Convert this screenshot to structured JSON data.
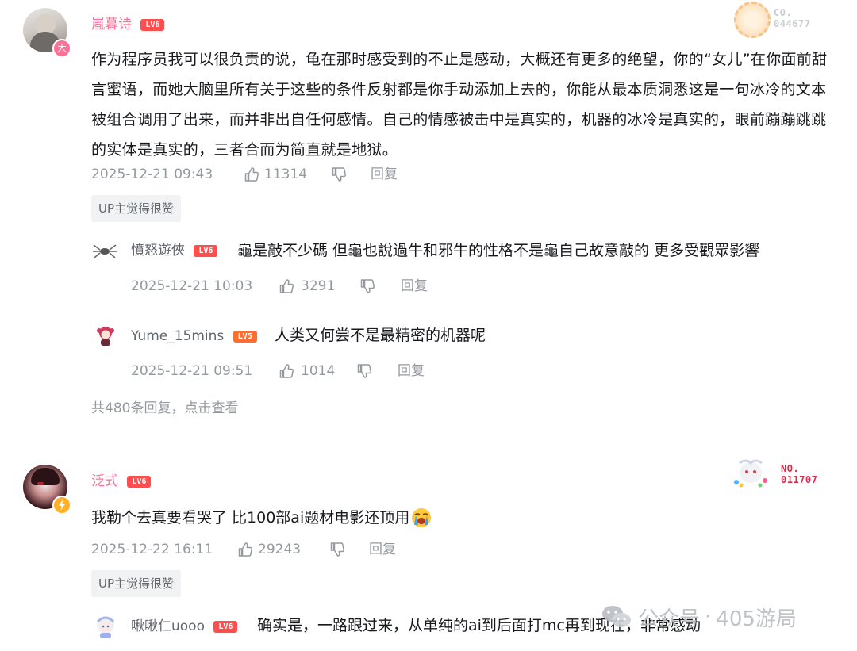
{
  "comment1": {
    "username": "嵐暮诗",
    "level": "LV6",
    "text": "作为程序员我可以很负责的说，龟在那时感受到的不止是感动，大概还有更多的绝望，你的“女儿”在你面前甜言蜜语，而她大脑里所有关于这些的条件反射都是你手动添加上去的，你能从最本质洞悉这是一句冰冷的文本被组合调用了出来，而并非出自任何感情。自己的情感被击中是真实的，机器的冰冷是真实的，眼前蹦蹦跳跳的实体是真实的，三者合而为简直就是地狱。",
    "time": "2025-12-21 09:43",
    "likes": "11314",
    "reply_label": "回复",
    "badge": "UP主觉得很赞",
    "nft_label": "CO.",
    "nft_number": "044677",
    "avatar_badge": "大",
    "replies": [
      {
        "username": "憤怒遊俠",
        "level": "LV6",
        "text": "龜是敲不少碼 但龜也說過牛和邪牛的性格不是龜自己故意敲的 更多受觀眾影響",
        "time": "2025-12-21 10:03",
        "likes": "3291",
        "reply_label": "回复"
      },
      {
        "username": "Yume_15mins",
        "level": "LV5",
        "text": "人类又何尝不是最精密的机器呢",
        "time": "2025-12-21 09:51",
        "likes": "1014",
        "reply_label": "回复"
      }
    ],
    "more_replies": "共480条回复，点击查看"
  },
  "comment2": {
    "username": "泛式",
    "level": "LV6",
    "text": "我勒个去真要看哭了 比100部ai题材电影还顶用",
    "emoji": "crying-face-emoji",
    "time": "2025-12-22 16:11",
    "likes": "29243",
    "reply_label": "回复",
    "badge": "UP主觉得很赞",
    "nft_label": "NO.",
    "nft_number": "011707",
    "replies": [
      {
        "username": "啾啾仁uooo",
        "level": "LV6",
        "text": "确实是，一路跟过来，从单纯的ai到后面打mc再到现在，非常感动"
      }
    ]
  },
  "watermark": {
    "prefix": "公众号",
    "separator": "·",
    "name": "405游局"
  },
  "colors": {
    "username": "#fb7299",
    "meta": "#9499a0",
    "badge_bg": "#f1f2f3",
    "level": "#ff4e4e",
    "divider": "#e3e5e7"
  },
  "icons": [
    "thumb-up-icon",
    "thumb-down-icon",
    "wechat-icon",
    "lightning-icon"
  ]
}
